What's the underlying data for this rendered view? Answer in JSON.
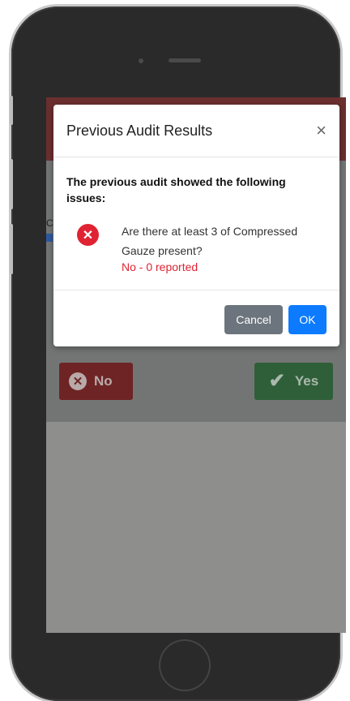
{
  "modal": {
    "title": "Previous Audit Results",
    "close_icon": "×",
    "heading": "The previous audit showed the following issues:",
    "issues": [
      {
        "icon": "error-circle-x-icon",
        "icon_glyph": "✕",
        "question": "Are there at least 3 of Compressed Gauze present?",
        "status": "No - 0 reported"
      }
    ],
    "cancel_label": "Cancel",
    "ok_label": "OK"
  },
  "background": {
    "no_label": "No",
    "yes_label": "Yes",
    "no_icon_glyph": "✕",
    "yes_icon_glyph": "✔",
    "cut_off_letter": "C"
  },
  "colors": {
    "error": "#e02332",
    "primary": "#0d7bff",
    "secondary": "#6c757d",
    "header_bg": "#6b2f2f"
  }
}
